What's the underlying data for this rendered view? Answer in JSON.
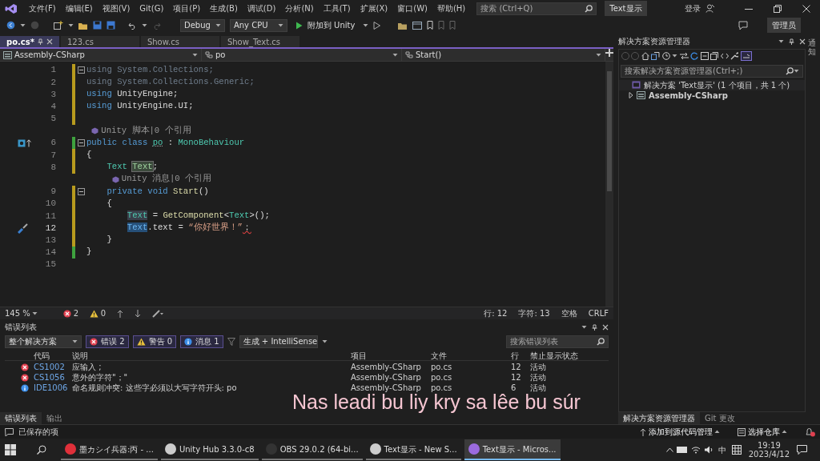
{
  "menu": [
    "文件(F)",
    "编辑(E)",
    "视图(V)",
    "Git(G)",
    "项目(P)",
    "生成(B)",
    "调试(D)",
    "分析(N)",
    "工具(T)",
    "扩展(X)",
    "窗口(W)",
    "帮助(H)"
  ],
  "search": {
    "placeholder": "搜索 (Ctrl+Q)"
  },
  "solution_badge": "Text显示",
  "login": "登录",
  "admin": "管理员",
  "toolbar": {
    "config": "Debug",
    "platform": "Any CPU",
    "attach": "附加到 Unity"
  },
  "tabs": [
    {
      "label": "po.cs*",
      "selected": true
    },
    {
      "label": "123.cs",
      "selected": false
    },
    {
      "label": "Show.cs",
      "selected": false
    },
    {
      "label": "Show_Text.cs",
      "selected": false
    }
  ],
  "nav": {
    "project": "Assembly-CSharp",
    "class": "po",
    "member": "Start()"
  },
  "code": [
    {
      "kind": "line",
      "num": "1",
      "fold": true,
      "saved": false,
      "tokens": [
        {
          "t": "using System.Collections;",
          "kind": "dim"
        }
      ]
    },
    {
      "kind": "line",
      "num": "2",
      "saved": false,
      "tokens": [
        {
          "t": "using System.Collections.Generic;",
          "kind": "dim"
        }
      ]
    },
    {
      "kind": "line",
      "num": "3",
      "saved": false,
      "tokens": [
        {
          "t": "using",
          "kind": "kw"
        },
        {
          "t": " UnityEngine;",
          "kind": "id"
        }
      ]
    },
    {
      "kind": "line",
      "num": "4",
      "saved": false,
      "tokens": [
        {
          "t": "using",
          "kind": "kw"
        },
        {
          "t": " UnityEngine.UI;",
          "kind": "id"
        }
      ]
    },
    {
      "kind": "line",
      "num": "5",
      "saved": false
    },
    {
      "kind": "lens",
      "text": "Unity 脚本|0 个引用"
    },
    {
      "kind": "line",
      "num": "6",
      "fold": true,
      "gutter": {
        "kind": "implements"
      },
      "saved": true,
      "tokens": [
        {
          "t": "public class ",
          "kind": "kw"
        },
        {
          "t": "po",
          "kind": "info"
        },
        {
          "t": " : ",
          "kind": "id"
        },
        {
          "t": "MonoBehaviour",
          "kind": "type"
        }
      ]
    },
    {
      "kind": "line",
      "num": "7",
      "saved": false,
      "tokens": [
        {
          "t": "{",
          "kind": "id"
        }
      ]
    },
    {
      "kind": "line",
      "num": "8",
      "saved": false,
      "tokens": [
        {
          "t": "    Text",
          "kind": "type"
        },
        {
          "t": " Text",
          "kind": "ref"
        },
        {
          "t": ";",
          "kind": "id"
        }
      ]
    },
    {
      "kind": "lens",
      "text": "Unity 消息|0 个引用"
    },
    {
      "kind": "line",
      "num": "9",
      "fold": true,
      "saved": false,
      "tokens": [
        {
          "t": "    private void ",
          "kind": "kw"
        },
        {
          "t": "Start",
          "kind": "method"
        },
        {
          "t": "()",
          "kind": "id"
        }
      ]
    },
    {
      "kind": "line",
      "num": "10",
      "saved": false,
      "tokens": [
        {
          "t": "    {",
          "kind": "id"
        }
      ]
    },
    {
      "kind": "line",
      "num": "11",
      "saved": false,
      "tokens": [
        {
          "t": "        Text",
          "kind": "hl"
        },
        {
          "t": " = ",
          "kind": "id"
        },
        {
          "t": "GetComponent",
          "kind": "method"
        },
        {
          "t": "<",
          "kind": "id"
        },
        {
          "t": "Text",
          "kind": "type"
        },
        {
          "t": ">();",
          "kind": "id"
        }
      ]
    },
    {
      "kind": "line",
      "num": "12",
      "gutter": {
        "kind": "quick-action"
      },
      "saved": false,
      "tokens": [
        {
          "t": "        Text",
          "kind": "sel"
        },
        {
          "t": ".text = ",
          "kind": "id"
        },
        {
          "t": "“你好世界！”",
          "kind": "str"
        },
        {
          "t": "；",
          "kind": "err"
        }
      ]
    },
    {
      "kind": "line",
      "num": "13",
      "saved": false,
      "tokens": [
        {
          "t": "    }",
          "kind": "id"
        }
      ]
    },
    {
      "kind": "line",
      "num": "14",
      "saved": true,
      "tokens": [
        {
          "t": "}",
          "kind": "id"
        }
      ]
    },
    {
      "kind": "line",
      "num": "15"
    }
  ],
  "editor_status": {
    "zoom": "145 %",
    "errors": "2",
    "warnings": "0",
    "line": "行: 12",
    "char": "字符: 13",
    "spaces": "空格",
    "eol": "CRLF"
  },
  "error_list": {
    "title": "错误列表",
    "scope": "整个解决方案",
    "errors": "错误 2",
    "warnings": "警告 0",
    "messages": "消息 1",
    "source": "生成 + IntelliSense",
    "search": {
      "placeholder": "搜索错误列表"
    },
    "columns": [
      "代码",
      "说明",
      "项目",
      "文件",
      "行",
      "禁止显示状态"
    ],
    "rows": [
      {
        "kind": "error",
        "code": "CS1002",
        "desc": "应输入 ;",
        "project": "Assembly-CSharp",
        "file": "po.cs",
        "line": "12",
        "state": "活动"
      },
      {
        "kind": "error",
        "code": "CS1056",
        "desc": "意外的字符\"；\"",
        "project": "Assembly-CSharp",
        "file": "po.cs",
        "line": "12",
        "state": "活动"
      },
      {
        "kind": "info",
        "code": "IDE1006",
        "desc": "命名规则冲突: 这些字必须以大写字符开头: po",
        "project": "Assembly-CSharp",
        "file": "po.cs",
        "line": "6",
        "state": "活动"
      }
    ]
  },
  "bottom_tabs": [
    {
      "label": "错误列表",
      "selected": true
    },
    {
      "label": "输出",
      "selected": false
    }
  ],
  "solution_explorer": {
    "title": "解决方案资源管理器",
    "search": {
      "placeholder": "搜索解决方案资源管理器(Ctrl+;)"
    },
    "tree": [
      {
        "label": "解决方案 'Text显示' (1 个项目，共 1 个)",
        "children": [
          {
            "label": "Assembly-CSharp",
            "expanded": false
          }
        ]
      }
    ]
  },
  "right_tabs": [
    {
      "label": "解决方案资源管理器",
      "selected": true
    },
    {
      "label": "Git 更改",
      "selected": false
    }
  ],
  "side_tab": "通知",
  "status_bar": {
    "message": "已保存的项",
    "source_control": "添加到源代码管理",
    "repo": "选择仓库"
  },
  "taskbar": {
    "apps": [
      {
        "label": "墨カシイ兵器:丙 - ...",
        "color": "#e0303a",
        "active": false
      },
      {
        "label": "Unity Hub 3.3.0-c8",
        "color": "#cccccc",
        "active": false
      },
      {
        "label": "OBS 29.0.2 (64-bi...",
        "color": "#333333",
        "active": false
      },
      {
        "label": "Text显示 - New S...",
        "color": "#cccccc",
        "active": false
      },
      {
        "label": "Text显示 - Micros...",
        "color": "#9b6bdf",
        "active": true
      }
    ],
    "ime": "中",
    "time": "19:19",
    "date": "2023/4/12"
  },
  "subtitle": "Nas leadi bu liy kry sa lêe bu súr"
}
